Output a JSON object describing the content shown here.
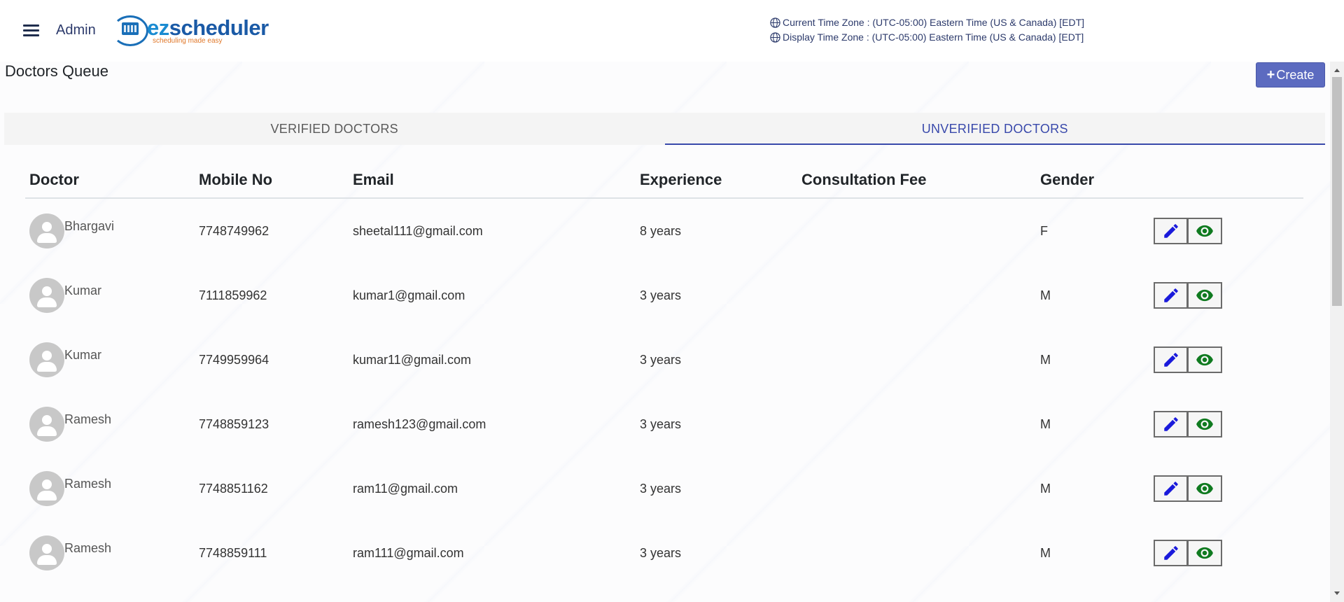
{
  "header": {
    "admin_label": "Admin",
    "logo_brand_prefix": "ez",
    "logo_brand_suffix": "scheduler",
    "logo_tagline": "scheduling made easy",
    "current_tz": "Current Time Zone : (UTC-05:00) Eastern Time (US & Canada) [EDT]",
    "display_tz": "Display Time Zone : (UTC-05:00) Eastern Time (US & Canada) [EDT]"
  },
  "page": {
    "title": "Doctors Queue",
    "create_label": "Create"
  },
  "tabs": [
    {
      "label": "VERIFIED DOCTORS",
      "active": false
    },
    {
      "label": "UNVERIFIED DOCTORS",
      "active": true
    }
  ],
  "table": {
    "columns": [
      "Doctor",
      "Mobile No",
      "Email",
      "Experience",
      "Consultation Fee",
      "Gender"
    ],
    "rows": [
      {
        "name": "Bhargavi",
        "mobile": "7748749962",
        "email": "sheetal111@gmail.com",
        "experience": "8 years",
        "fee": "",
        "gender": "F"
      },
      {
        "name": "Kumar",
        "mobile": "7111859962",
        "email": "kumar1@gmail.com",
        "experience": "3 years",
        "fee": "",
        "gender": "M"
      },
      {
        "name": "Kumar",
        "mobile": "7749959964",
        "email": "kumar11@gmail.com",
        "experience": "3 years",
        "fee": "",
        "gender": "M"
      },
      {
        "name": "Ramesh",
        "mobile": "7748859123",
        "email": "ramesh123@gmail.com",
        "experience": "3 years",
        "fee": "",
        "gender": "M"
      },
      {
        "name": "Ramesh",
        "mobile": "7748851162",
        "email": "ram11@gmail.com",
        "experience": "3 years",
        "fee": "",
        "gender": "M"
      },
      {
        "name": "Ramesh",
        "mobile": "7748859111",
        "email": "ram111@gmail.com",
        "experience": "3 years",
        "fee": "",
        "gender": "M"
      }
    ]
  },
  "colors": {
    "accent": "#3949ab",
    "create_button": "#5c6bc0",
    "edit_icon": "#1a1adb",
    "view_icon": "#0f7a1f"
  },
  "icons": {
    "menu": "menu-icon",
    "globe": "globe-icon",
    "edit": "pencil-icon",
    "view": "eye-icon",
    "avatar": "person-icon"
  }
}
